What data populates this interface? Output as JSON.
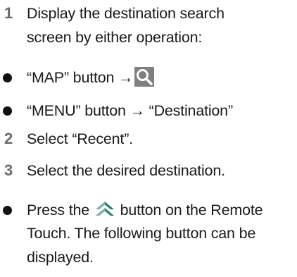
{
  "steps": [
    {
      "number": "1",
      "line1": "Display the destination search",
      "line2": "screen by either operation:"
    },
    {
      "number": "2",
      "text": "Select “Recent”."
    },
    {
      "number": "3",
      "text": "Select the desired destination."
    }
  ],
  "bullets": [
    {
      "text_before_icon": "“MAP” button →",
      "icon": "magnifier-search-icon"
    },
    {
      "text": "“MENU” button → “Destination”"
    }
  ],
  "note": {
    "before_icon": "Press the",
    "icon": "double-chevron-up-icon",
    "after_icon": "button on the Remote",
    "line2": "Touch. The following button can be",
    "line3": "displayed."
  },
  "colors": {
    "step_number": "#6b6b6b",
    "search_icon_bg": "#808080",
    "up_icon_teal": "#2e7d77",
    "text": "#1a1a1a"
  }
}
